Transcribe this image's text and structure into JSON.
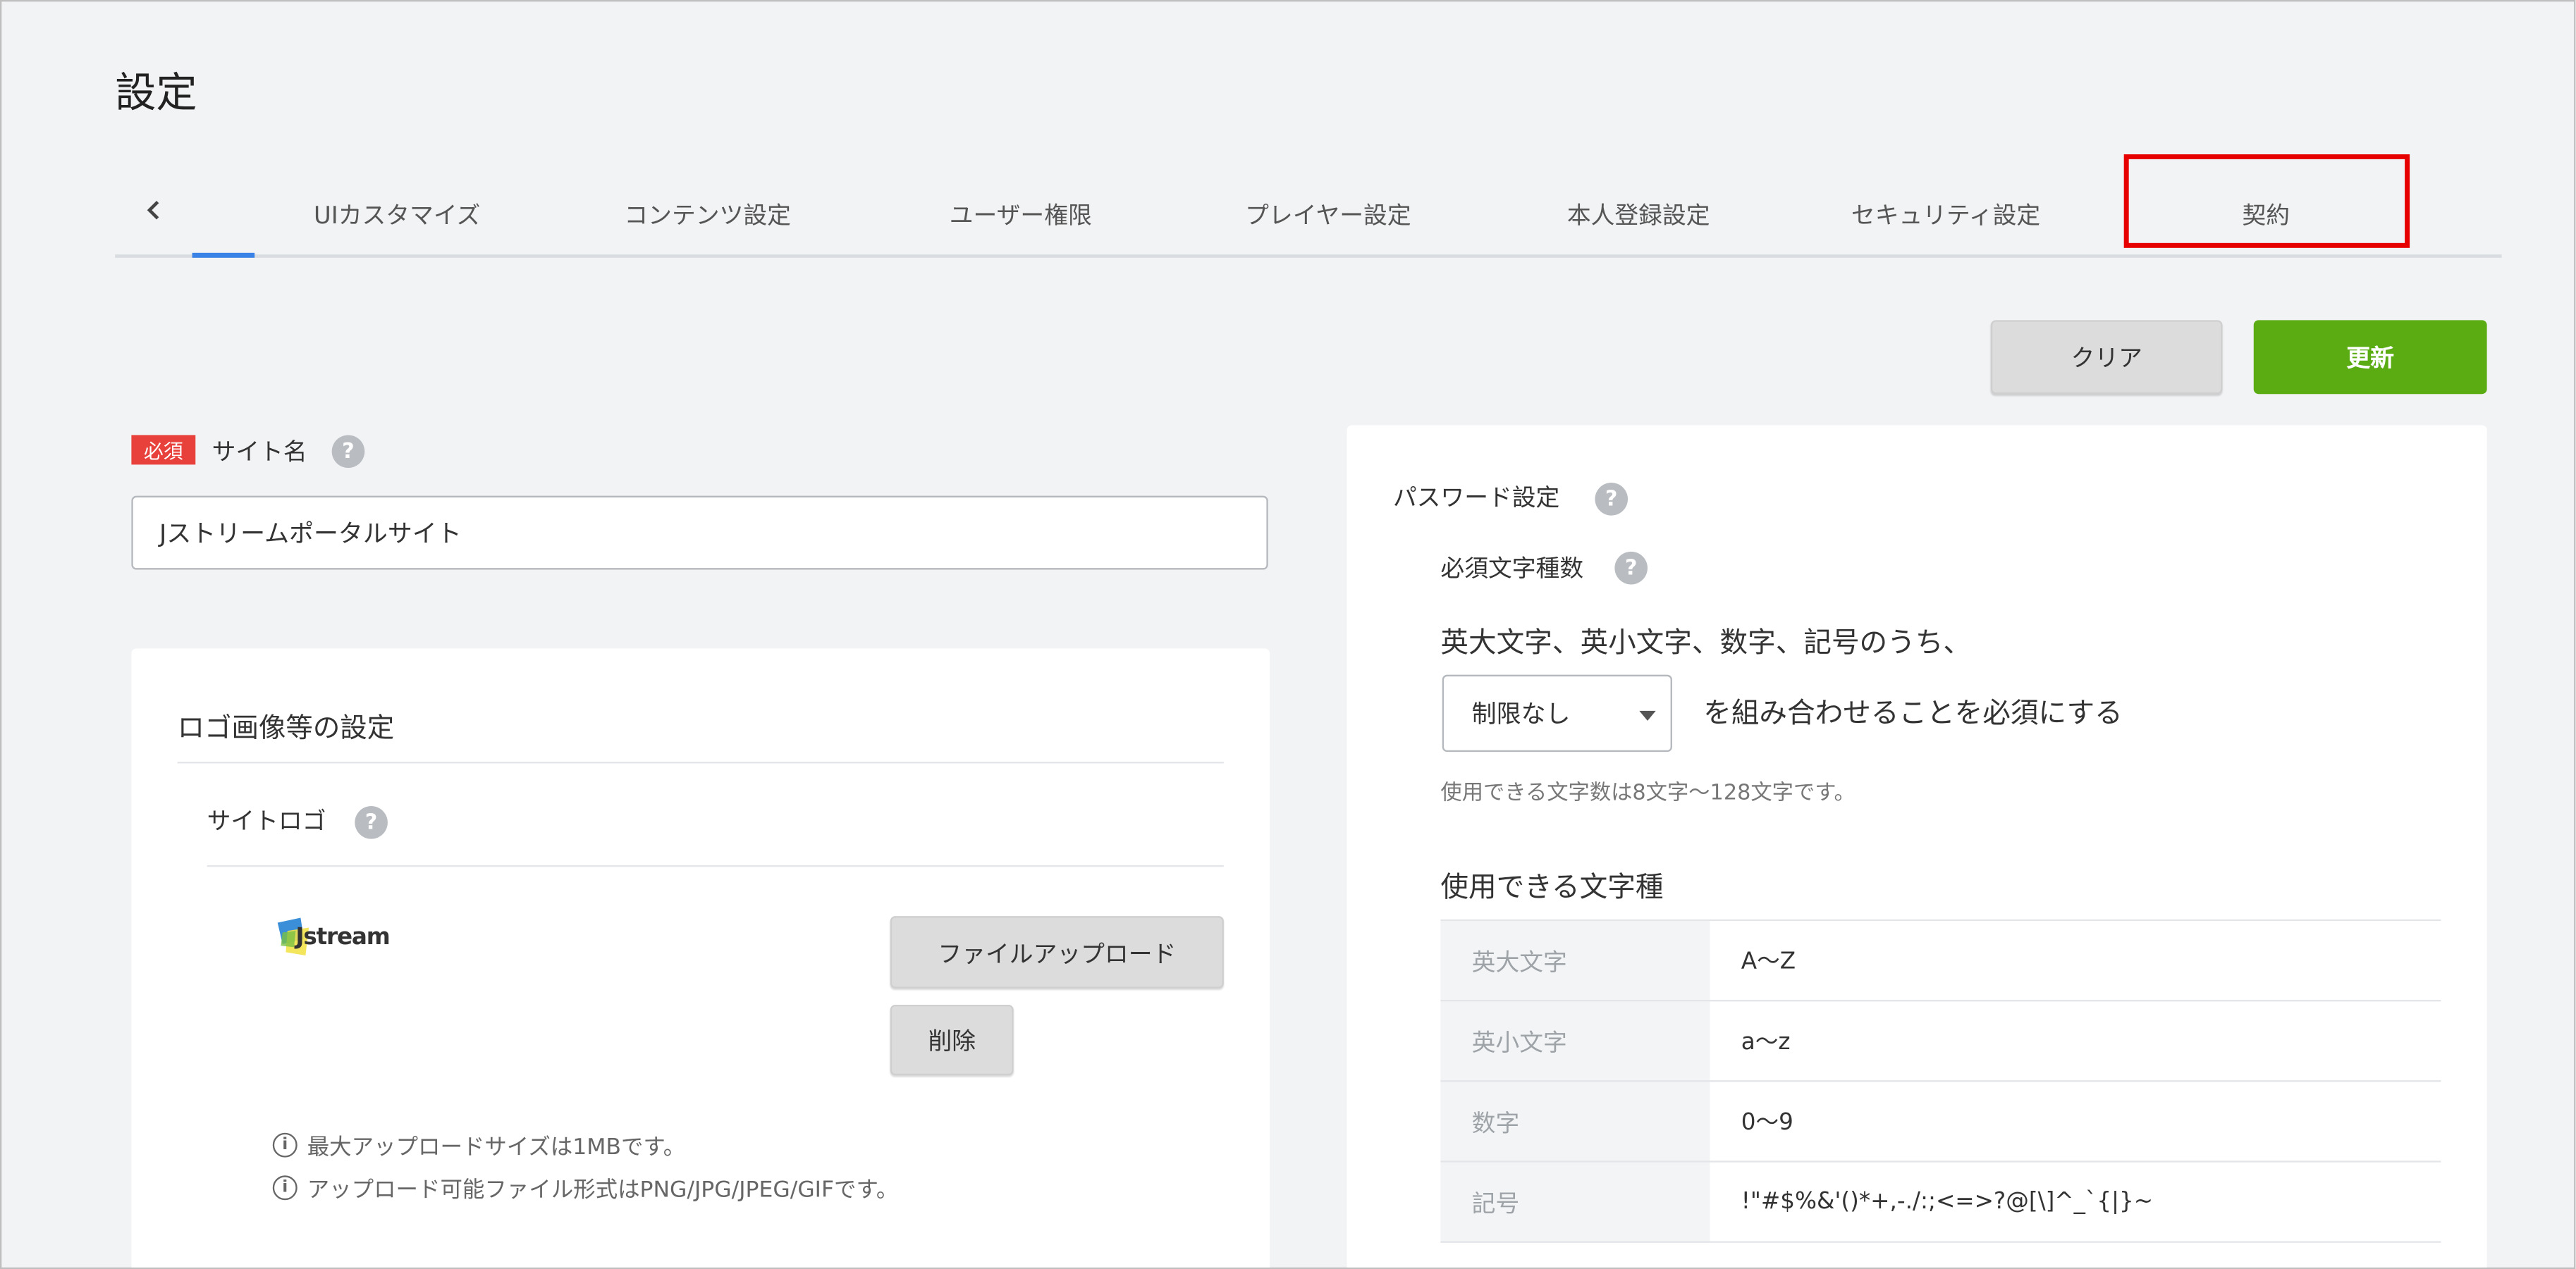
{
  "page": {
    "title": "設定"
  },
  "tabs": {
    "back_icon": "chevron-left-icon",
    "items": [
      {
        "label": "UIカスタマイズ"
      },
      {
        "label": "コンテンツ設定"
      },
      {
        "label": "ユーザー権限"
      },
      {
        "label": "プレイヤー設定"
      },
      {
        "label": "本人登録設定"
      },
      {
        "label": "セキュリティ設定"
      },
      {
        "label": "契約"
      }
    ],
    "active_color": "#3b82e6",
    "highlight_color": "#e60000"
  },
  "toolbar": {
    "clear_label": "クリア",
    "update_label": "更新",
    "update_color": "#5aac12"
  },
  "site_name": {
    "required_badge": "必須",
    "label": "サイト名",
    "help": "?",
    "value": "Jストリームポータルサイト"
  },
  "logo_settings": {
    "heading": "ロゴ画像等の設定",
    "site_logo_label": "サイトロゴ",
    "help": "?",
    "logo_text": "Jstream",
    "upload_label": "ファイルアップロード",
    "delete_label": "削除",
    "info_icon": "i",
    "notes": [
      "最大アップロードサイズは1MBです。",
      "アップロード可能ファイル形式はPNG/JPG/JPEG/GIFです。"
    ]
  },
  "password": {
    "heading": "パスワード設定",
    "help": "?",
    "required_types_label": "必須文字種数",
    "intro": "英大文字、英小文字、数字、記号のうち、",
    "select_value": "制限なし",
    "suffix": "を組み合わせることを必須にする",
    "length_note": "使用できる文字数は8文字〜128文字です。",
    "char_types_heading": "使用できる文字種",
    "char_types": [
      {
        "name": "英大文字",
        "value": "A〜Z"
      },
      {
        "name": "英小文字",
        "value": "a〜z"
      },
      {
        "name": "数字",
        "value": "0〜9"
      },
      {
        "name": "記号",
        "value": "!\"#$%&'()*+,-./:;<=>?@[\\]^_`{|}~"
      }
    ]
  }
}
